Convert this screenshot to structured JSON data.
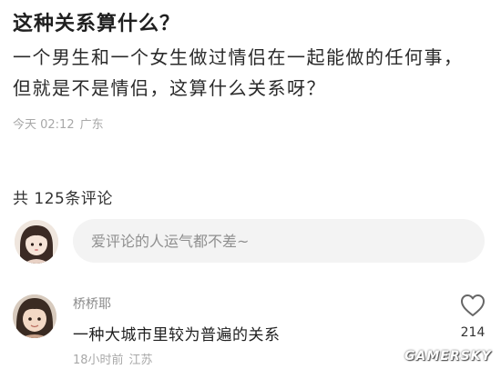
{
  "post": {
    "title": "这种关系算什么？",
    "body": "一个男生和一个女生做过情侣在一起能做的任何事，但就是不是情侣，这算什么关系呀？",
    "time": "今天 02:12",
    "location": "广东"
  },
  "comments_section": {
    "count_label": "共 125条评论",
    "input_placeholder": "爱评论的人运气都不差~"
  },
  "comment": {
    "author": "桥桥耶",
    "text": "一种大城市里较为普遍的关系",
    "time": "18小时前",
    "location": "江苏",
    "like_count": "214"
  },
  "watermark": "GAMERSKY",
  "icons": {
    "like": "heart-outline-icon",
    "composer_avatar": "avatar",
    "commenter_avatar": "avatar"
  },
  "colors": {
    "background": "#ffffff",
    "meta_text": "#a8a8a8",
    "input_bg": "#f3f3f3"
  }
}
